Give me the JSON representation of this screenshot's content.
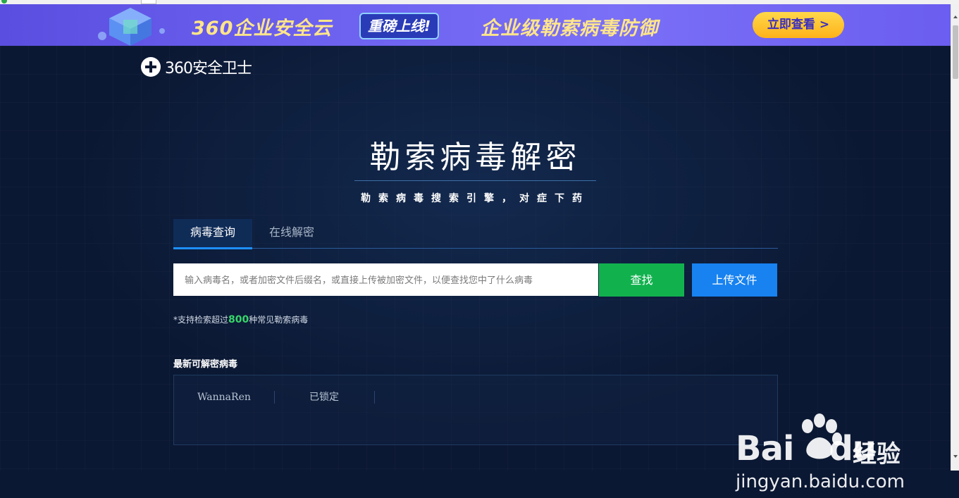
{
  "banner": {
    "title": "360企业安全云",
    "badge": "重磅上线!",
    "subtitle": "企业级勒索病毒防御",
    "cta": "立即查看 >"
  },
  "logo": {
    "text": "360安全卫士"
  },
  "hero": {
    "title": "勒索病毒解密",
    "subtitle": "勒索病毒搜索引擎，对症下药"
  },
  "tabs": [
    {
      "label": "病毒查询",
      "active": true
    },
    {
      "label": "在线解密",
      "active": false
    }
  ],
  "search": {
    "placeholder": "输入病毒名，或者加密文件后缀名，或直接上传被加密文件，以便查找您中了什么病毒",
    "value": "",
    "find_label": "查找",
    "upload_label": "上传文件"
  },
  "support": {
    "prefix": "*支持检索超过",
    "count": "800",
    "suffix": "种常见勒索病毒"
  },
  "latest": {
    "title": "最新可解密病毒",
    "items": [
      "WannaRen",
      "已锁定"
    ]
  },
  "watermark": {
    "brand": "Bai",
    "brand2": "du",
    "cn": "经验",
    "url": "jingyan.baidu.com"
  },
  "colors": {
    "background": "#0b1833",
    "find_button": "#11b24e",
    "upload_button": "#1782f0",
    "accent_count": "#36d66a",
    "banner": "#6d62f0"
  }
}
